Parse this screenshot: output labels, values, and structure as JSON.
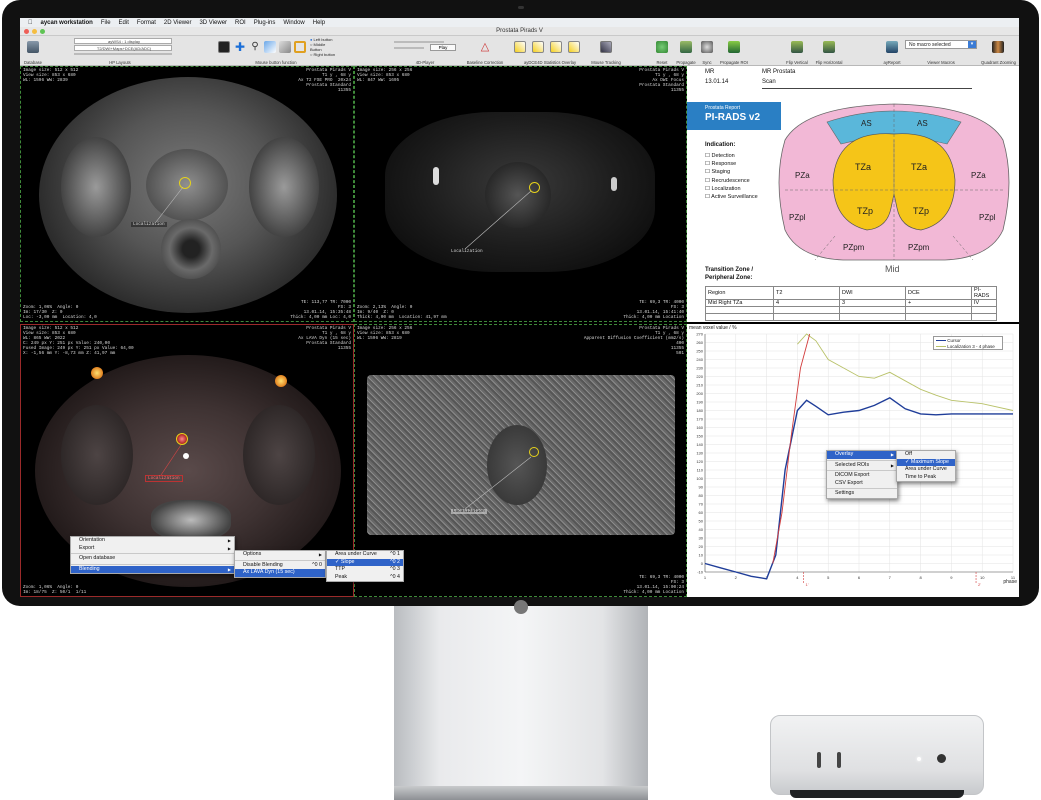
{
  "menubar": {
    "app_name": "aycan workstation",
    "items": [
      "File",
      "Edit",
      "Format",
      "2D Viewer",
      "3D Viewer",
      "ROI",
      "Plug-ins",
      "Window",
      "Help"
    ]
  },
  "window": {
    "title": "Prostata Pirads V"
  },
  "toolbar": {
    "database_label": "Database",
    "hp_layouts_label": "HP Layouts",
    "hp_select_1": "ayWS4 : 1 display",
    "hp_select_2": "T2/DWI+Maps+DCE(AD/ADC)",
    "mouse_button_label": "Mouse button function",
    "radio_options": [
      "Left button",
      "Middle Button",
      "Right button"
    ],
    "player_label": "4D-Player",
    "play_label": "Play",
    "baseline_label": "Baseline Correction",
    "dce_label": "ayDCE4D Statistics Overlay",
    "mouse_tracking_label": "Mouse Tracking",
    "reset_label": "Reset",
    "propagate_label": "Propagate",
    "sync_label": "Sync",
    "propagate_roi_label": "Propagate ROI",
    "flip_vertical_label": "Flip Vertical",
    "flip_horizontal_label": "Flip Horizontal",
    "ayreport_label": "ayReport",
    "viewer_macros_label": "Viewer Macros",
    "macros_value": "No macro selected",
    "quadrant_zoom_label": "Quadrant Zooming"
  },
  "viewport1": {
    "overlay_tl": "Image size: 512 x 512\nView size: 853 x 680\nWL: 1596 WW: 2839",
    "overlay_tr": "Prostata Pirads V\nT1 y , 68 y\nAx T2 FSE PRO  20x24\nProstata Standard\n11355",
    "overlay_bl": "Zoom: 1,06%  Angle: 0\nIm: 17/30  Z: 0\nLoc: -3,00 mm  Location: 4,0",
    "overlay_br": "TE: 113,77 TR: 7000\nFS: 3\n13.01.14, 15:35:48\nThick: 4,00 mm Loc: 4,0",
    "roi_label": "Localization"
  },
  "viewport2": {
    "overlay_tl": "Image size: 256 x 256\nView size: 853 x 680\nWL: 847 WW: 1695",
    "overlay_tr": "Prostata Pirads V\nT1 y , 68 y\nAx DWI Focus\nProstata Standard\n11355",
    "overlay_bl": "Zoom: 2,13%  Angle: 0\nIm: 9/40  Z: 0\nThick: 4,00 mm  Location: 41,97 mm",
    "overlay_br": "TE: 69,3 TR: 4000\nFS: 3\n13.01.14, 15:41:40\nThick: 4,00 mm Location",
    "roi_label": "Localization"
  },
  "viewport3": {
    "overlay_tl": "Image size: 512 x 512\nView size: 853 x 680\nWL: 865 WW: 2022\nC: 249 px Y: 251 px Value: 240,00\nFused Image: 249 px Y: 251 px Value: 64,00\nX: -1,56 mm Y: -8,73 mm Z: 41,97 mm",
    "overlay_tr": "Prostata Pirads V\nT1 y , 68 y\nAx LAVA Dyn (15 sec)\nProstata Standard\n11355",
    "overlay_bl": "Zoom: 1,06%  Angle: 0\nIm: 18/75  Z: 50/1  1/11",
    "roi_label": "Localization"
  },
  "viewport4": {
    "overlay_tl": "Image size: 256 x 256\nView size: 853 x 680\nWL: 1596 WW: 2819",
    "overlay_tr": "Prostata Pirads V\nT1 y , 68 y\nApparent Diffusion Coefficient (mm2/s)\n400\n11355\n501",
    "overlay_br": "TE: 69,3 TR: 4000\nFS: 3\n13.01.14, 15:00:24\nThick: 4,00 mm Location",
    "roi_label": "Localization"
  },
  "report": {
    "modality": "MR",
    "study": "MR Prostata",
    "date": "13.01.14",
    "scan": "Scan",
    "logo_line1": "Prostata Report",
    "logo_line2": "PI-RADS v2",
    "indication_title": "Indication:",
    "indications": [
      "Detection",
      "Response",
      "Staging",
      "Recrudescence",
      "Localization",
      "Active Surveillance"
    ],
    "zones": {
      "as_left": "AS",
      "as_right": "AS",
      "tza_left": "TZa",
      "tza_right": "TZa",
      "tzp_left": "TZp",
      "tzp_right": "TZp",
      "pza_left": "PZa",
      "pza_right": "PZa",
      "pzpl_left": "PZpl",
      "pzpl_right": "PZpl",
      "pzpm_left": "PZpm",
      "pzpm_right": "PZpm"
    },
    "level": "Mid",
    "zone_title_1": "Transition Zone /",
    "zone_title_2": "Peripheral Zone:",
    "table_headers": [
      "Region",
      "T2",
      "DWI",
      "DCE",
      "PI-RADS"
    ],
    "table_rows": [
      [
        "Mid Right TZa",
        "4",
        "3",
        "+",
        "IV"
      ]
    ]
  },
  "chart_data": {
    "type": "line",
    "ylabel": "mean voxel value / %",
    "xlabel": "phase",
    "ylim": [
      -10,
      270
    ],
    "xlim": [
      1,
      11
    ],
    "yticks": [
      -10,
      0,
      10,
      20,
      30,
      40,
      50,
      60,
      70,
      80,
      90,
      100,
      110,
      120,
      130,
      140,
      150,
      160,
      170,
      180,
      190,
      200,
      210,
      220,
      230,
      240,
      250,
      260,
      270
    ],
    "xticks": [
      1,
      2,
      3,
      4,
      5,
      6,
      7,
      8,
      9,
      10,
      11
    ],
    "legend": [
      "Cursor",
      "Localization 3 - 4 phase"
    ],
    "legend_position": "top-right",
    "series": [
      {
        "name": "Cursor",
        "color": "#1f3d99",
        "x": [
          1,
          1.5,
          2,
          2.5,
          3,
          3.3,
          3.6,
          4,
          4.3,
          4.6,
          5,
          5.5,
          6,
          6.5,
          7,
          7.5,
          8,
          8.5,
          9,
          10,
          11
        ],
        "y": [
          0,
          -5,
          -10,
          -15,
          -18,
          10,
          110,
          180,
          192,
          185,
          175,
          178,
          180,
          186,
          195,
          182,
          176,
          175,
          176,
          176,
          176
        ]
      },
      {
        "name": "Localization 3 - 4 phase",
        "color": "#b9c26a",
        "x": [
          4,
          4.3,
          4.6,
          5,
          5.5,
          6,
          6.5,
          7,
          7.5,
          8,
          8.5,
          9,
          10,
          11
        ],
        "y": [
          258,
          270,
          262,
          240,
          230,
          220,
          218,
          225,
          215,
          205,
          198,
          192,
          188,
          180
        ]
      },
      {
        "name": "",
        "color": "#d23c3c",
        "x": [
          3.2,
          3.5,
          3.8,
          4.1,
          4.4
        ],
        "y": [
          0,
          60,
          150,
          230,
          270
        ]
      }
    ],
    "markers": [
      {
        "x": 4.2,
        "label": "1'"
      },
      {
        "x": 9.8,
        "label": "2'"
      }
    ]
  },
  "menus": {
    "ctx1": [
      "Orientation",
      "Export",
      "Open database",
      "Blending"
    ],
    "ctx2": [
      "Options",
      "Disable Blending",
      "Ax LAVA Dyn (15 sec)"
    ],
    "ctx2_short": "^0 0",
    "ctx3": [
      "Area under Curve",
      "Slope",
      "TTP",
      "Peak"
    ],
    "ctx3_short": [
      "^0 1",
      "^0 2",
      "^0 3",
      "^0 4"
    ],
    "ctx4": [
      "Overlay",
      "Selected ROIs",
      "DICOM Export",
      "CSV Export",
      "Settings"
    ],
    "ctx5": [
      "Off",
      "Maximum Slope",
      "Area under Curve",
      "Time to Peak"
    ]
  }
}
